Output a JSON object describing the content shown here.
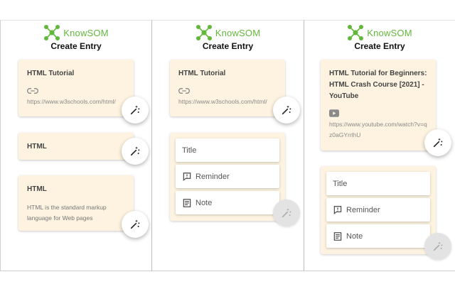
{
  "brand": {
    "name": "KnowSOM",
    "color": "#62b83a"
  },
  "screen_title": "Create Entry",
  "panel1": {
    "card1": {
      "title": "HTML Tutorial",
      "url": "https://www.w3schools.com/html/"
    },
    "card2": {
      "title": "HTML"
    },
    "card3": {
      "title": "HTML",
      "description": "HTML is the standard markup language for Web pages"
    }
  },
  "panel2": {
    "card1": {
      "title": "HTML Tutorial",
      "url": "https://www.w3schools.com/html/"
    },
    "menu": {
      "title": "Title",
      "reminder": "Reminder",
      "note": "Note"
    }
  },
  "panel3": {
    "card1": {
      "title": "HTML Tutorial for Beginners: HTML Crash Course [2021] - YouTube",
      "url": "https://www.youtube.com/watch?v=qz0aGYrrlhU"
    },
    "menu": {
      "title": "Title",
      "reminder": "Reminder",
      "note": "Note"
    }
  },
  "colors": {
    "card_bg": "#fdf3e0",
    "fab_bg": "#ffffff",
    "fab_disabled": "#e3e3e3"
  },
  "icons": {
    "logo": "molecule-logo-icon",
    "link": "link-icon",
    "video": "youtube-icon",
    "magic": "magic-wand-icon",
    "reminder": "reminder-icon",
    "note": "note-icon"
  }
}
